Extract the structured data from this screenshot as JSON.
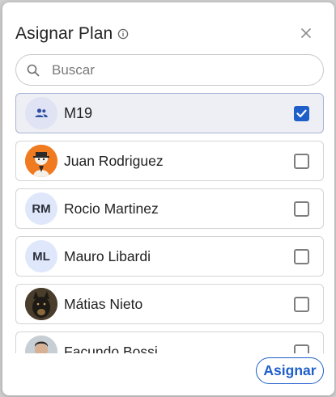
{
  "dialog": {
    "title": "Asignar Plan",
    "search": {
      "placeholder": "Buscar",
      "value": ""
    },
    "items": [
      {
        "label": "M19",
        "avatar": "group",
        "checked": true
      },
      {
        "label": "Juan Rodriguez",
        "avatar": "photo",
        "checked": false
      },
      {
        "label": "Rocio Martinez",
        "avatar": "RM",
        "checked": false
      },
      {
        "label": "Mauro Libardi",
        "avatar": "ML",
        "checked": false
      },
      {
        "label": "Mátias Nieto",
        "avatar": "photo",
        "checked": false
      },
      {
        "label": "Facundo Bossi",
        "avatar": "photo",
        "checked": false
      }
    ],
    "submit_label": "Asignar"
  },
  "colors": {
    "accent": "#1f5fc9",
    "selected_bg": "#eeeff4",
    "initials_bg": "#dfe8fb"
  },
  "icons": {
    "info": "info-icon",
    "close": "close-icon",
    "search": "search-icon",
    "group": "group-icon",
    "check": "check-icon"
  }
}
